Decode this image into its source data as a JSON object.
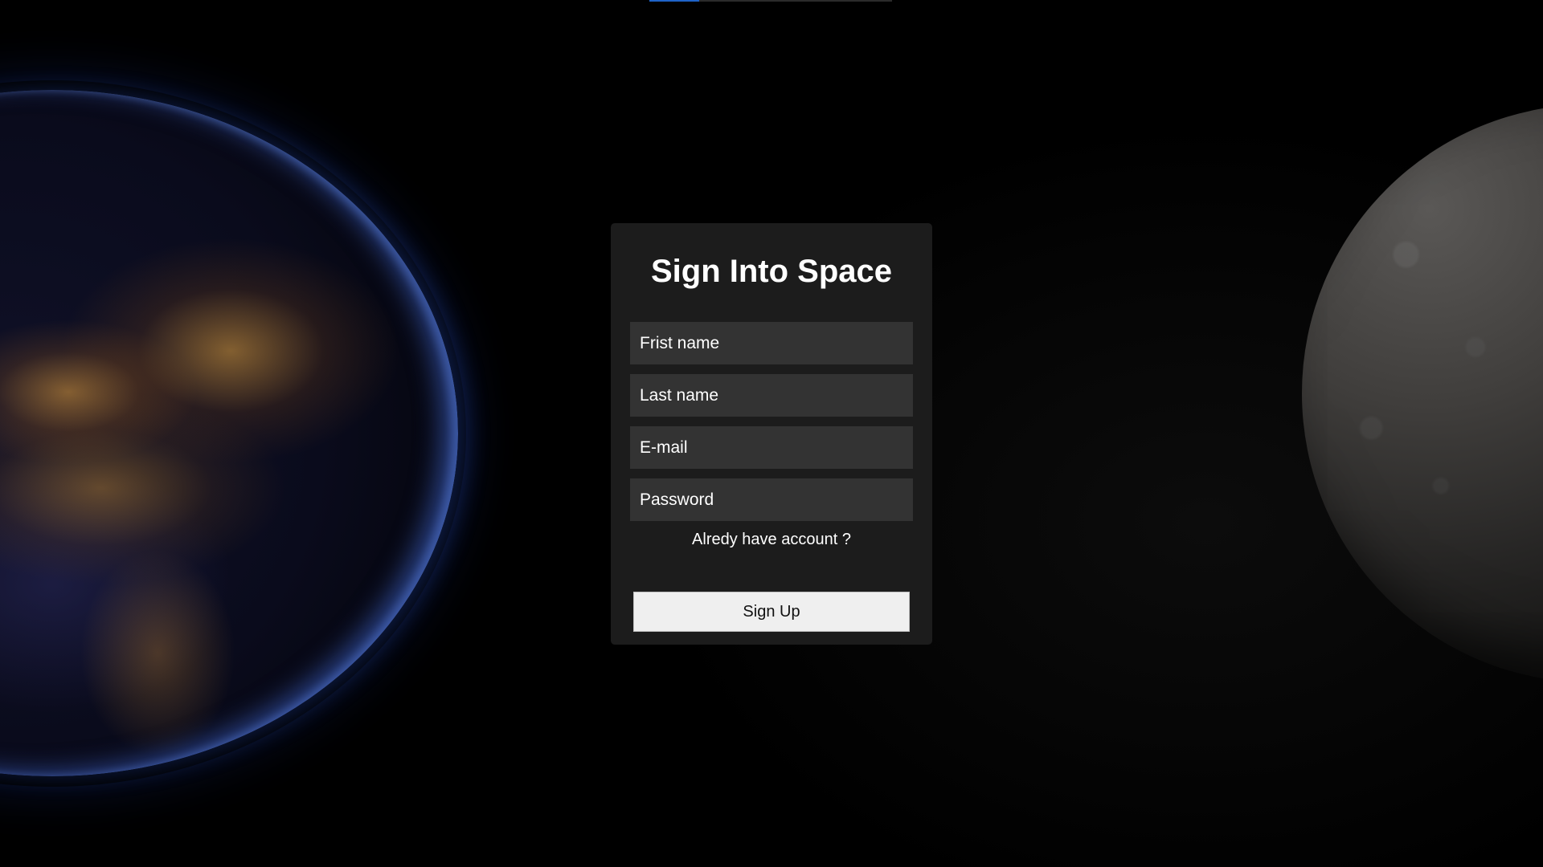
{
  "page": {
    "title": "Sign Into Space"
  },
  "form": {
    "fields": [
      {
        "placeholder": "Frist name",
        "value": ""
      },
      {
        "placeholder": "Last name",
        "value": ""
      },
      {
        "placeholder": "E-mail",
        "value": ""
      },
      {
        "placeholder": "Password",
        "value": ""
      }
    ],
    "account_link": "Alredy have account ?",
    "submit_label": "Sign Up"
  },
  "colors": {
    "card_background": "#1c1c1c",
    "field_background": "#333333",
    "button_background": "#efefef",
    "text": "#ffffff",
    "accent": "#1e63c8"
  }
}
